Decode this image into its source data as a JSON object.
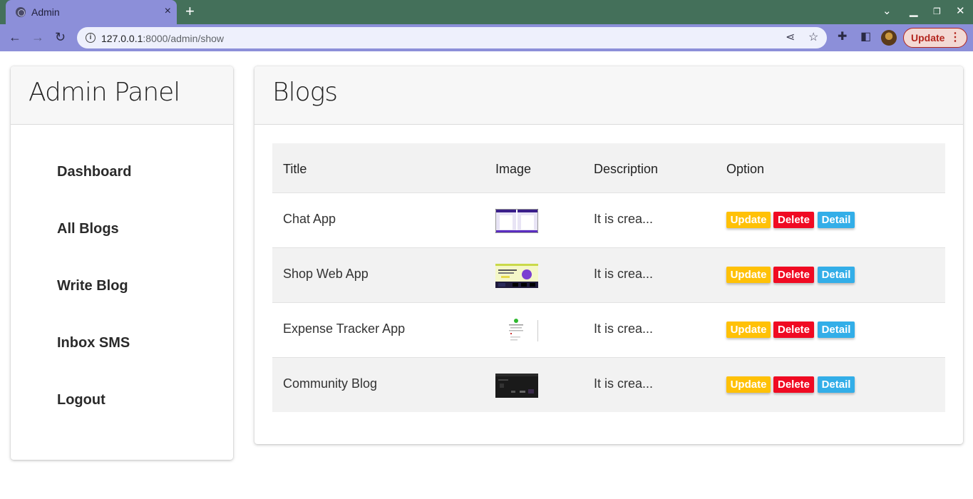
{
  "browser": {
    "tab_title": "Admin",
    "tab_close": "×",
    "new_tab": "+",
    "url_host": "127.0.0.1",
    "url_rest": ":8000/admin/show",
    "update_label": "Update",
    "icons": {
      "back": "back-arrow-icon",
      "forward": "forward-arrow-icon",
      "reload": "reload-icon",
      "info": "info-icon",
      "share": "share-icon",
      "star": "bookmark-star-icon",
      "extensions": "puzzle-icon",
      "sidepanel": "side-panel-icon",
      "profile": "profile-avatar",
      "menu": "kebab-menu-icon",
      "minimize": "minimize-icon",
      "restore": "restore-icon",
      "close": "close-window-icon",
      "tabsearch": "chevron-down-icon"
    }
  },
  "sidebar": {
    "title": "Admin Panel",
    "items": [
      {
        "label": "Dashboard"
      },
      {
        "label": "All Blogs"
      },
      {
        "label": "Write Blog"
      },
      {
        "label": "Inbox SMS"
      },
      {
        "label": "Logout"
      }
    ]
  },
  "main": {
    "title": "Blogs",
    "columns": [
      "Title",
      "Image",
      "Description",
      "Option"
    ],
    "rows": [
      {
        "title": "Chat App",
        "description": "It is crea...",
        "image": "chat-app-thumbnail"
      },
      {
        "title": "Shop Web App",
        "description": "It is crea...",
        "image": "shop-web-app-thumbnail"
      },
      {
        "title": "Expense Tracker App",
        "description": "It is crea...",
        "image": "expense-tracker-thumbnail"
      },
      {
        "title": "Community Blog",
        "description": "It is crea...",
        "image": "community-blog-thumbnail"
      }
    ],
    "actions": {
      "update": "Update",
      "delete": "Delete",
      "detail": "Detail"
    }
  },
  "colors": {
    "update": "#ffc107",
    "delete": "#f00a22",
    "detail": "#33aee8",
    "chrome_accent": "#8c8fd9",
    "tabbar": "#44705a"
  }
}
